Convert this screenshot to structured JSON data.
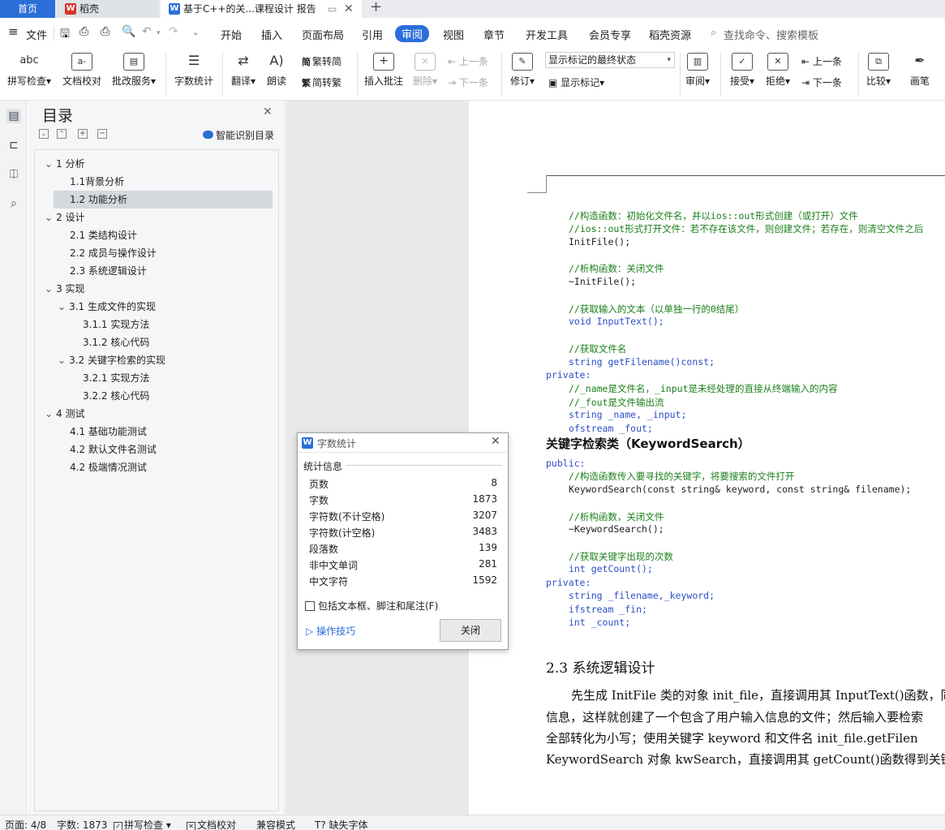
{
  "tabs": {
    "home": "首页",
    "daoke": "稻壳",
    "doc": "基于C++的关...课程设计 报告"
  },
  "menu": {
    "file": "文件",
    "items": [
      "开始",
      "插入",
      "页面布局",
      "引用",
      "审阅",
      "视图",
      "章节",
      "开发工具",
      "会员专享",
      "稻壳资源"
    ],
    "active": "审阅",
    "search": "查找命令、搜索模板"
  },
  "ribbon": {
    "spell": "拼写检查",
    "proof": "文档校对",
    "comment_service": "批改服务",
    "wordcount": "字数统计",
    "translate": "翻译",
    "read": "朗读",
    "trad": "繁转简",
    "simp": "简转繁",
    "insert_comment": "插入批注",
    "delete": "删除",
    "prev1": "上一条",
    "next1": "下一条",
    "revise": "修订",
    "markup_select": "显示标记的最终状态",
    "show_markup": "显示标记",
    "review": "审阅",
    "accept": "接受",
    "reject": "拒绝",
    "prev2": "上一条",
    "next2": "下一条",
    "compare": "比较",
    "pen": "画笔",
    "icon_spell": "abc",
    "icon_proof": "a-",
    "icon_trad": "简",
    "icon_simp": "繁"
  },
  "toc": {
    "title": "目录",
    "smart": "智能识别目录",
    "items": [
      {
        "label": "1   分析"
      },
      {
        "label": "1.1背景分析"
      },
      {
        "label": "1.2  功能分析"
      },
      {
        "label": "2  设计"
      },
      {
        "label": "2.1  类结构设计"
      },
      {
        "label": "2.2  成员与操作设计"
      },
      {
        "label": "2.3  系统逻辑设计"
      },
      {
        "label": "3  实现"
      },
      {
        "label": "3.1  生成文件的实现"
      },
      {
        "label": "3.1.1  实现方法"
      },
      {
        "label": "3.1.2  核心代码"
      },
      {
        "label": "3.2  关键字检索的实现"
      },
      {
        "label": "3.2.1  实现方法"
      },
      {
        "label": "3.2.2  核心代码"
      },
      {
        "label": "4  测试"
      },
      {
        "label": "4.1  基础功能测试"
      },
      {
        "label": "4.2  默认文件名测试"
      },
      {
        "label": "4.2  极端情况测试"
      }
    ]
  },
  "doc": {
    "code1": [
      "//构造函数：初始化文件名，并以ios::out形式创建（或打开）文件",
      "//ios::out形式打开文件：若不存在该文件，则创建文件；若存在，则清空文件之后",
      "InitFile();",
      "//析构函数：关闭文件",
      "~InitFile();",
      "//获取输入的文本（以单独一行的0结尾）",
      "void InputText();",
      "//获取文件名",
      "string getFilename()const;",
      "private:",
      "//_name是文件名，_input是未经处理的直接从终端输入的内容",
      "//_fout是文件输出流",
      "string _name, _input;",
      "ofstream _fout;"
    ],
    "heading_class": "关键字检索类（KeywordSearch）",
    "code2": [
      "public:",
      "//构造函数传入要寻找的关键字，将要搜索的文件打开",
      "KeywordSearch(const string& keyword, const string& filename);",
      "//析构函数，关闭文件",
      "~KeywordSearch();",
      "//获取关键字出现的次数",
      "int getCount();",
      "private:",
      "string _filename,_keyword;",
      "ifstream _fin;",
      "int _count;"
    ],
    "section_heading": "2.3  系统逻辑设计",
    "para": [
      "先生成 InitFile 类的对象 init_file，直接调用其 InputText()函数，同",
      "信息，这样就创建了一个包含了用户输入信息的文件；然后输入要检索",
      "全部转化为小写；使用关键字 keyword 和文件名 init_file.getFilen",
      "KeywordSearch 对象 kwSearch，直接调用其 getCount()函数得到关键字出"
    ]
  },
  "dialog": {
    "title": "字数统计",
    "group": "统计信息",
    "rows": [
      {
        "label": "页数",
        "value": "8"
      },
      {
        "label": "字数",
        "value": "1873"
      },
      {
        "label": "字符数(不计空格)",
        "value": "3207"
      },
      {
        "label": "字符数(计空格)",
        "value": "3483"
      },
      {
        "label": "段落数",
        "value": "139"
      },
      {
        "label": "非中文单词",
        "value": "281"
      },
      {
        "label": "中文字符",
        "value": "1592"
      }
    ],
    "checkbox": "包括文本框、脚注和尾注(F)",
    "tips": "操作技巧",
    "close": "关闭"
  },
  "status": {
    "page": "页面: 4/8",
    "words": "字数: 1873",
    "spell": "拼写检查",
    "proof": "文档校对",
    "compat": "兼容模式",
    "missing_font": "缺失字体"
  },
  "colors": {
    "accent": "#2b6ed8",
    "comment_green": "#1a7f1a",
    "keyword_blue": "#2a4ec9"
  }
}
